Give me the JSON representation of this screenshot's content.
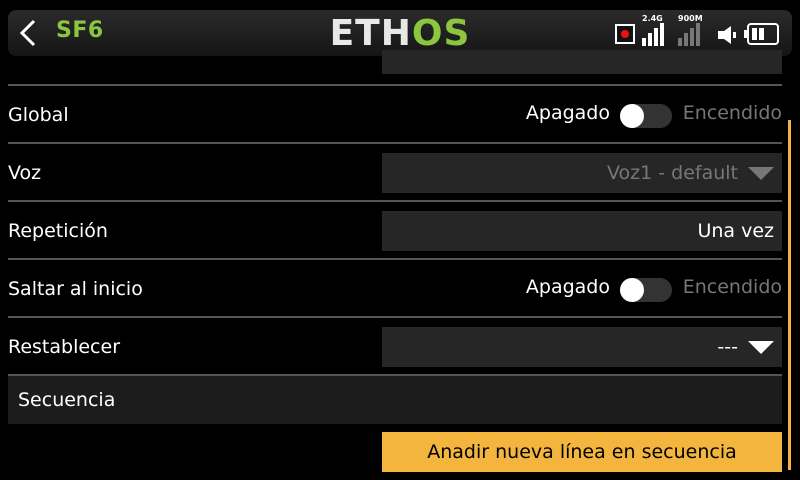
{
  "header": {
    "title": "SF6",
    "logo_left": "ETH",
    "logo_right": "OS",
    "signal1_label": "2.4G",
    "signal2_label": "900M"
  },
  "rows": [
    {
      "label": "Global",
      "toggle_off": "Apagado",
      "toggle_on": "Encendido"
    },
    {
      "label": "Voz",
      "value": "Voz1 - default"
    },
    {
      "label": "Repetición",
      "value": "Una vez"
    },
    {
      "label": "Saltar al inicio",
      "toggle_off": "Apagado",
      "toggle_on": "Encendido"
    },
    {
      "label": "Restablecer",
      "value": "---"
    }
  ],
  "sequence": {
    "label": "Secuencia",
    "add_button": "Anadir nueva línea en secuencia"
  },
  "colors": {
    "accent": "#f4b53f",
    "brand": "#8cc63f"
  }
}
